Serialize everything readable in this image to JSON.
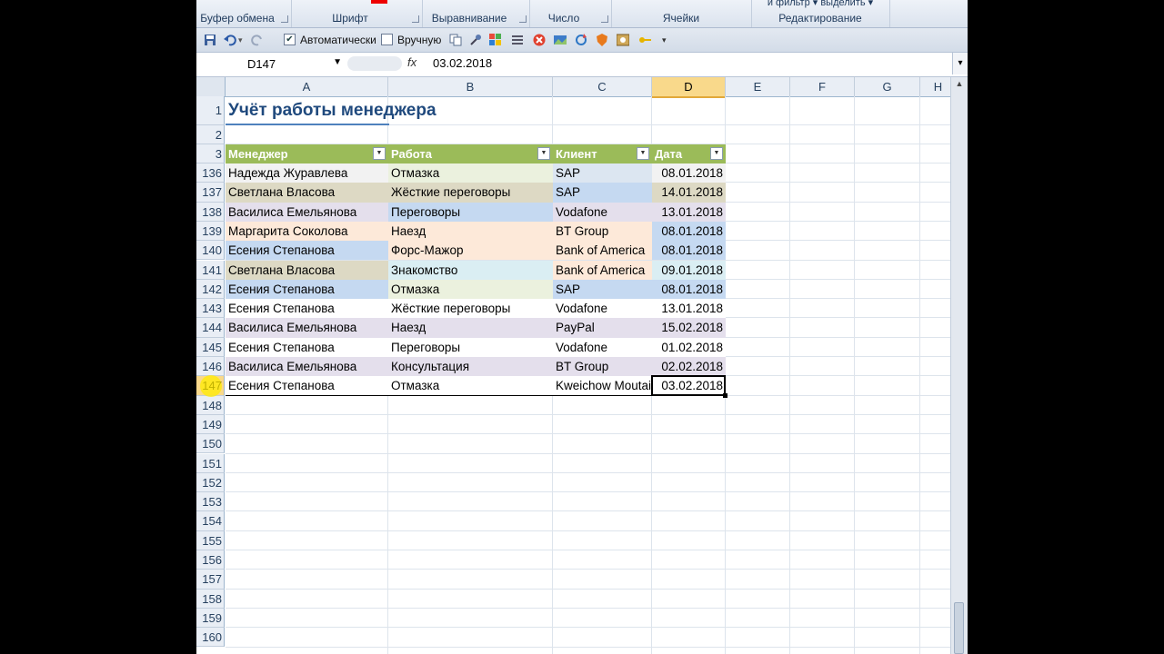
{
  "ribbon": {
    "groups": [
      "Буфер обмена",
      "Шрифт",
      "Выравнивание",
      "Число",
      "Ячейки",
      "Редактирование"
    ],
    "editing_top": "и фильтр ▾  выделить ▾"
  },
  "qat": {
    "auto_label": "Автоматически",
    "auto_checked": true,
    "manual_label": "Вручную",
    "manual_checked": false
  },
  "formula_bar": {
    "name_box": "D147",
    "fx": "fx",
    "value": "03.02.2018"
  },
  "sheet": {
    "columns": [
      "A",
      "B",
      "C",
      "D",
      "E",
      "F",
      "G",
      "H"
    ],
    "selected_column": "D",
    "title": "Учёт работы менеджера",
    "table_headers": [
      "Менеджер",
      "Работа",
      "Клиент",
      "Дата"
    ],
    "top_rows": [
      "1",
      "2",
      "3"
    ],
    "rows": [
      {
        "n": "136",
        "a": "Надежда Журавлева",
        "b": "Отмазка",
        "c": "SAP",
        "d": "08.01.2018"
      },
      {
        "n": "137",
        "a": "Светлана Власова",
        "b": "Жёсткие переговоры",
        "c": "SAP",
        "d": "14.01.2018"
      },
      {
        "n": "138",
        "a": "Василиса Емельянова",
        "b": "Переговоры",
        "c": "Vodafone",
        "d": "13.01.2018"
      },
      {
        "n": "139",
        "a": "Маргарита Соколова",
        "b": "Наезд",
        "c": "BT Group",
        "d": "08.01.2018"
      },
      {
        "n": "140",
        "a": "Есения Степанова",
        "b": "Форс-Мажор",
        "c": "Bank of America",
        "d": "08.01.2018"
      },
      {
        "n": "141",
        "a": "Светлана Власова",
        "b": "Знакомство",
        "c": "Bank of America",
        "d": "09.01.2018"
      },
      {
        "n": "142",
        "a": "Есения Степанова",
        "b": "Отмазка",
        "c": "SAP",
        "d": "08.01.2018"
      },
      {
        "n": "143",
        "a": "Есения Степанова",
        "b": "Жёсткие переговоры",
        "c": "Vodafone",
        "d": "13.01.2018"
      },
      {
        "n": "144",
        "a": "Василиса Емельянова",
        "b": "Наезд",
        "c": "PayPal",
        "d": "15.02.2018"
      },
      {
        "n": "145",
        "a": "Есения Степанова",
        "b": "Переговоры",
        "c": "Vodafone",
        "d": "01.02.2018"
      },
      {
        "n": "146",
        "a": "Василиса Емельянова",
        "b": "Консультация",
        "c": "BT Group",
        "d": "02.02.2018"
      },
      {
        "n": "147",
        "a": "Есения Степанова",
        "b": "Отмазка",
        "c": "Kweichow Moutai",
        "d": "03.02.2018"
      }
    ],
    "empty_rows": [
      "148",
      "149",
      "150",
      "151",
      "152",
      "153",
      "154",
      "155",
      "156",
      "157",
      "158",
      "159",
      "160"
    ],
    "selected_row": "147",
    "cell_colors": {
      "136": [
        "#f2f2f2",
        "#ebf1de",
        "#dce6f1",
        "#f2f2f2"
      ],
      "137": [
        "#ddd9c4",
        "#ddd9c4",
        "#c5d9f1",
        "#ddd9c4"
      ],
      "138": [
        "#e4dfec",
        "#c5d9f1",
        "#e4dfec",
        "#e4dfec"
      ],
      "139": [
        "#fde9d9",
        "#fde9d9",
        "#fde9d9",
        "#c5d9f1"
      ],
      "140": [
        "#c5d9f1",
        "#fde9d9",
        "#fde9d9",
        "#c5d9f1"
      ],
      "141": [
        "#ddd9c4",
        "#daeef3",
        "#fde9d9",
        "#daeef3"
      ],
      "142": [
        "#c5d9f1",
        "#ebf1de",
        "#c5d9f1",
        "#c5d9f1"
      ],
      "143": [
        "#ffffff",
        "#ffffff",
        "#ffffff",
        "#ffffff"
      ],
      "144": [
        "#e4dfec",
        "#e4dfec",
        "#e4dfec",
        "#e4dfec"
      ],
      "145": [
        "#ffffff",
        "#ffffff",
        "#ffffff",
        "#ffffff"
      ],
      "146": [
        "#e4dfec",
        "#e4dfec",
        "#e4dfec",
        "#e4dfec"
      ],
      "147": [
        "#ffffff",
        "#ffffff",
        "#ffffff",
        "#ffffff"
      ]
    },
    "header_color": "#9bbb59",
    "title_color": "#1f497d"
  }
}
